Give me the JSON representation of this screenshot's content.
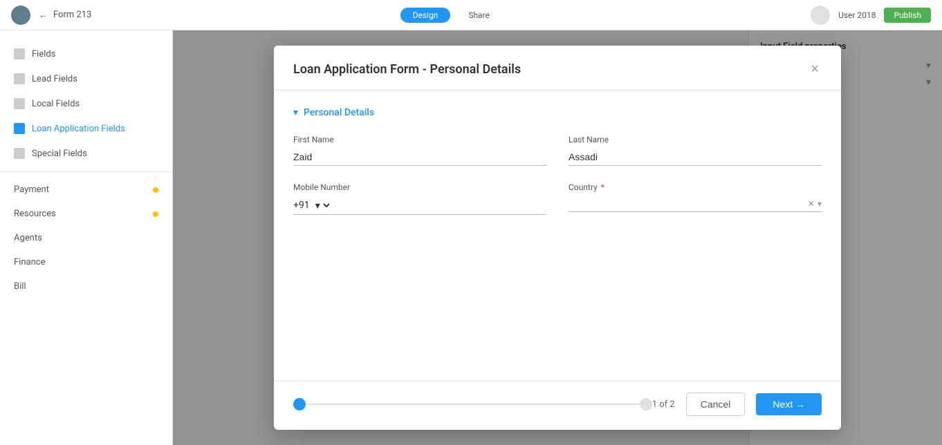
{
  "modal": {
    "title": "Loan Application Form - Personal Details",
    "close_label": "×",
    "section": {
      "title": "Personal Details",
      "chevron": "▾"
    },
    "fields": {
      "first_name": {
        "label": "First Name",
        "value": "Zaid",
        "placeholder": "First Name"
      },
      "last_name": {
        "label": "Last Name",
        "value": "Assadi",
        "placeholder": "Last Name"
      },
      "mobile_number": {
        "label": "Mobile Number",
        "code": "+91",
        "placeholder": ""
      },
      "country": {
        "label": "Country",
        "required": true,
        "value": "",
        "placeholder": ""
      }
    },
    "footer": {
      "page_indicator": "1 of 2",
      "cancel_label": "Cancel",
      "next_label": "Next →",
      "progress_dots": [
        {
          "active": true
        },
        {
          "active": false
        }
      ]
    }
  },
  "sidebar": {
    "items": [
      {
        "label": "Fields"
      },
      {
        "label": "Lead Fields"
      },
      {
        "label": "Local Fields"
      },
      {
        "label": "Loan Application Fields"
      },
      {
        "label": "Special Fields"
      }
    ],
    "sections": [
      {
        "label": "Payment"
      },
      {
        "label": "Resources"
      },
      {
        "label": "Agents"
      },
      {
        "label": "Finance"
      },
      {
        "label": "Bill"
      }
    ]
  },
  "topbar": {
    "title": "Form 213"
  }
}
